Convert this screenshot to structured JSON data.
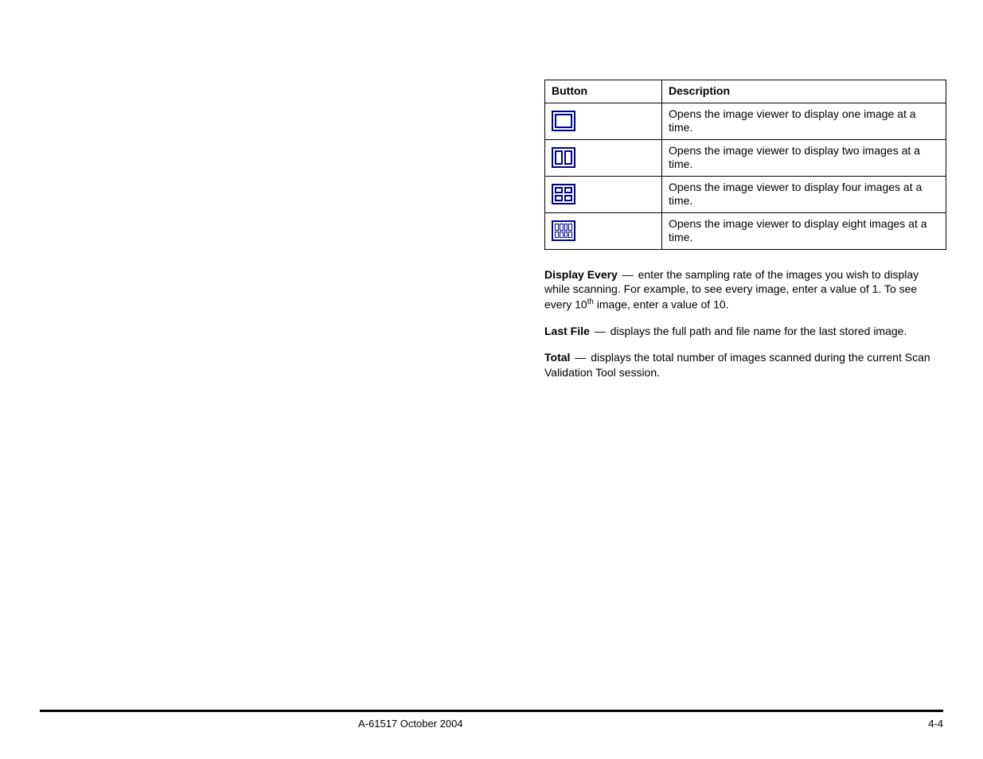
{
  "table": {
    "headers": {
      "button": "Button",
      "description": "Description"
    },
    "rows": [
      {
        "icon": "view-one-icon",
        "desc": "Opens the image viewer to display one image at a time."
      },
      {
        "icon": "view-two-icon",
        "desc": "Opens the image viewer to display two images at a time."
      },
      {
        "icon": "view-four-icon",
        "desc": "Opens the image viewer to display four images at a time."
      },
      {
        "icon": "view-eight-icon",
        "desc": "Opens the image viewer to display eight images at a time."
      }
    ]
  },
  "paras": {
    "display_every": {
      "lead": "Display Every",
      "sep": "—",
      "text_before_sup": "enter the sampling rate of the images you wish to display while scanning. For example, to see every image, enter a value of 1. To see every 10",
      "sup": "th",
      "text_after_sup": " image, enter a value of 10."
    },
    "last_file": {
      "lead": "Last File",
      "sep": "—",
      "text": "displays the full path and file name for the last stored image."
    },
    "total": {
      "lead": "Total",
      "sep": "—",
      "text": "displays the total number of images scanned during the current Scan Validation Tool session."
    }
  },
  "footer": {
    "left": "A-61517 October 2004",
    "right": "4-4"
  }
}
